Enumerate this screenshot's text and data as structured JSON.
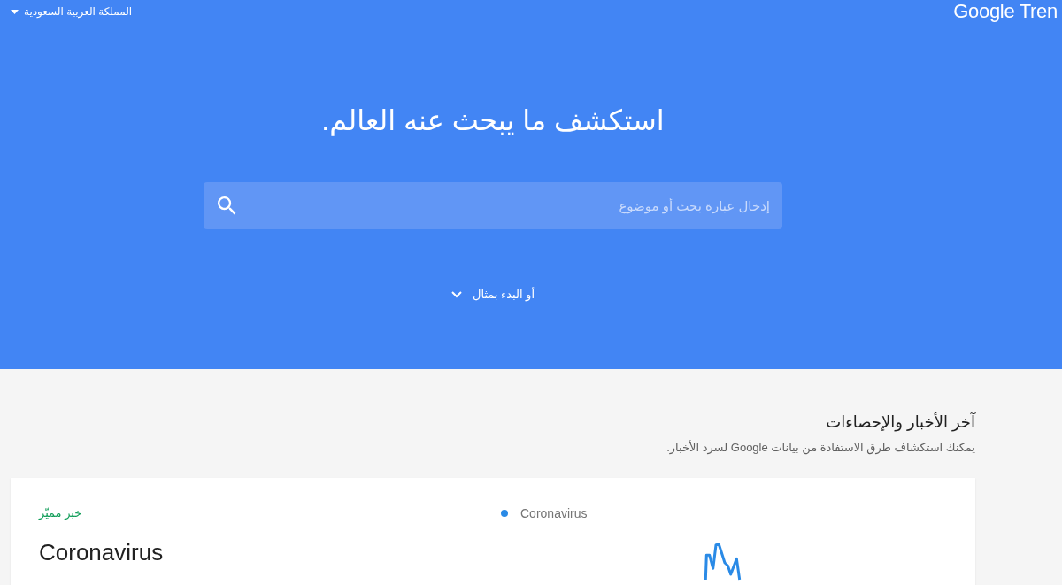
{
  "top_bar": {
    "region_selector": {
      "label": "المملكة العربية السعودية"
    },
    "logo": "Google Tren"
  },
  "hero": {
    "title": "استكشف ما يبحث عنه العالم.",
    "search": {
      "placeholder": "إدخال عبارة بحث أو موضوع"
    },
    "examples_toggle": {
      "label": "أو البدء بمثال",
      "expanded": false
    }
  },
  "news": {
    "title": "آخر الأخبار والإحصاءات",
    "subtitle": "يمكنك استكشاف طرق الاستفادة من بيانات Google لسرد الأخبار.",
    "cards": [
      {
        "tag": "خبر مميّز",
        "title": "Coronavirus",
        "legend": [
          "Coronavirus"
        ]
      }
    ]
  }
}
